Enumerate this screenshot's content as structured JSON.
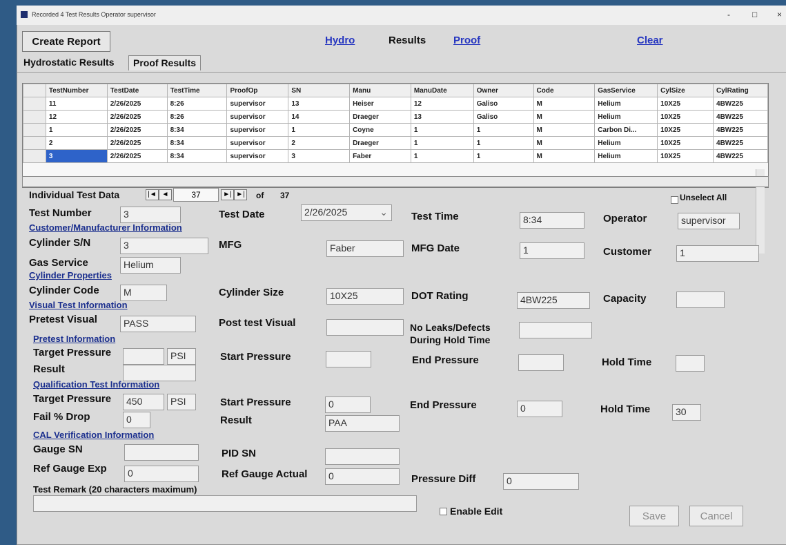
{
  "window": {
    "title": "Recorded 4 Test Results Operator supervisor",
    "minimize": "-",
    "maximize": "□",
    "close": "×"
  },
  "toolbar": {
    "create_report": "Create Report",
    "hydro": "Hydro",
    "results": "Results",
    "proof": "Proof",
    "clear": "Clear"
  },
  "tabs": [
    "Hydrostatic Results",
    "Proof Results"
  ],
  "grid": {
    "columns": [
      "TestNumber",
      "TestDate",
      "TestTime",
      "ProofOp",
      "SN",
      "Manu",
      "ManuDate",
      "Owner",
      "Code",
      "GasService",
      "CylSize",
      "CylRating"
    ],
    "rows": [
      [
        "11",
        "2/26/2025",
        "8:26",
        "supervisor",
        "13",
        "Heiser",
        "12",
        "Galiso",
        "M",
        "Helium",
        "10X25",
        "4BW225"
      ],
      [
        "12",
        "2/26/2025",
        "8:26",
        "supervisor",
        "14",
        "Draeger",
        "13",
        "Galiso",
        "M",
        "Helium",
        "10X25",
        "4BW225"
      ],
      [
        "1",
        "2/26/2025",
        "8:34",
        "supervisor",
        "1",
        "Coyne",
        "1",
        "1",
        "M",
        "Carbon Di...",
        "10X25",
        "4BW225"
      ],
      [
        "2",
        "2/26/2025",
        "8:34",
        "supervisor",
        "2",
        "Draeger",
        "1",
        "1",
        "M",
        "Helium",
        "10X25",
        "4BW225"
      ],
      [
        "3",
        "2/26/2025",
        "8:34",
        "supervisor",
        "3",
        "Faber",
        "1",
        "1",
        "M",
        "Helium",
        "10X25",
        "4BW225"
      ]
    ]
  },
  "detail": {
    "title": "Individual Test Data",
    "record": "37",
    "of_label": "of",
    "total": "37",
    "unselect_all": "Unselect All",
    "nav": [
      "|◄",
      "◄",
      "►|",
      "►|"
    ],
    "fields": {
      "test_number_label": "Test Number",
      "test_number": "3",
      "test_date_label": "Test Date",
      "test_date": "2/26/2025",
      "test_time_label": "Test Time",
      "test_time": "8:34",
      "operator_label": "Operator",
      "operator": "supervisor",
      "customer_manufacturer_section": "Customer/Manufacturer Information",
      "cylinder_sn_label": "Cylinder S/N",
      "cylinder_sn": "3",
      "mfg_label": "MFG",
      "mfg": "Faber",
      "mfg_date_label": "MFG Date",
      "mfg_date": "1",
      "customer_label": "Customer",
      "customer": "1",
      "gas_service_label": "Gas Service",
      "gas_service": "Helium",
      "cylinder_properties_section": "Cylinder Properties",
      "cylinder_code_label": "Cylinder Code",
      "cylinder_code": "M",
      "cylinder_size_label": "Cylinder Size",
      "cylinder_size": "10X25",
      "dot_rating_label": "DOT Rating",
      "dot_rating": "4BW225",
      "capacity_label": "Capacity",
      "capacity": "",
      "visual_test_section": "Visual Test Information",
      "pretest_visual_label": "Pretest Visual",
      "pretest_visual": "PASS",
      "posttest_visual_label": "Post test Visual",
      "posttest_visual": "",
      "no_leaks_label": "No Leaks/Defects",
      "no_leaks_label_2": "During Hold Time",
      "no_leaks": "",
      "pretest_information_section": "Pretest Information",
      "pretest_target_pressure_label": "Target Pressure",
      "pretest_target_pressure": "",
      "pretest_units": "PSI",
      "pretest_start_pressure_label": "Start Pressure",
      "pretest_start_pressure": "",
      "pretest_end_pressure_label": "End Pressure",
      "pretest_end_pressure": "",
      "pretest_hold_time_label": "Hold Time",
      "pretest_hold_time": "",
      "pretest_result_label": "Result",
      "pretest_result": "",
      "qualification_section": "Qualification Test Information",
      "qual_target_pressure_label": "Target Pressure",
      "qual_target_pressure": "450",
      "qual_units": "PSI",
      "qual_start_pressure_label": "Start Pressure",
      "qual_start_pressure": "0",
      "qual_end_pressure_label": "End Pressure",
      "qual_end_pressure": "0",
      "qual_hold_time_label": "Hold Time",
      "qual_hold_time": "30",
      "fail_drop_label": "Fail % Drop",
      "fail_drop": "0",
      "qual_result_label": "Result",
      "qual_result": "PAA",
      "cal_section": "CAL Verification Information",
      "gauge_sn_label": "Gauge SN",
      "gauge_sn": "",
      "pid_sn_label": "PID SN",
      "pid_sn": "",
      "ref_gauge_exp_label": "Ref Gauge Exp",
      "ref_gauge_exp": "0",
      "ref_gauge_actual_label": "Ref Gauge Actual",
      "ref_gauge_actual": "0",
      "pressure_diff_label": "Pressure Diff",
      "pressure_diff": "0",
      "test_remark_label": "Test Remark (20 characters maximum)",
      "test_remark": "",
      "enable_edit": "Enable Edit"
    },
    "buttons": {
      "save": "Save",
      "cancel": "Cancel"
    }
  }
}
